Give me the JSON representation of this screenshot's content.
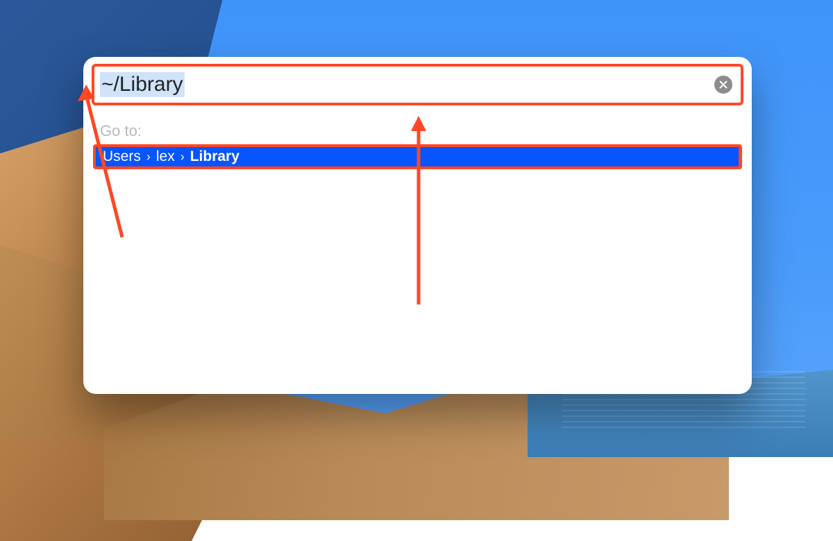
{
  "input": {
    "value": "~/Library"
  },
  "label": {
    "goto": "Go to:"
  },
  "result": {
    "crumbs": [
      "Users",
      "lex",
      "Library"
    ],
    "bold_index": 2
  },
  "annotation": {
    "highlight_color": "#ff4726"
  }
}
